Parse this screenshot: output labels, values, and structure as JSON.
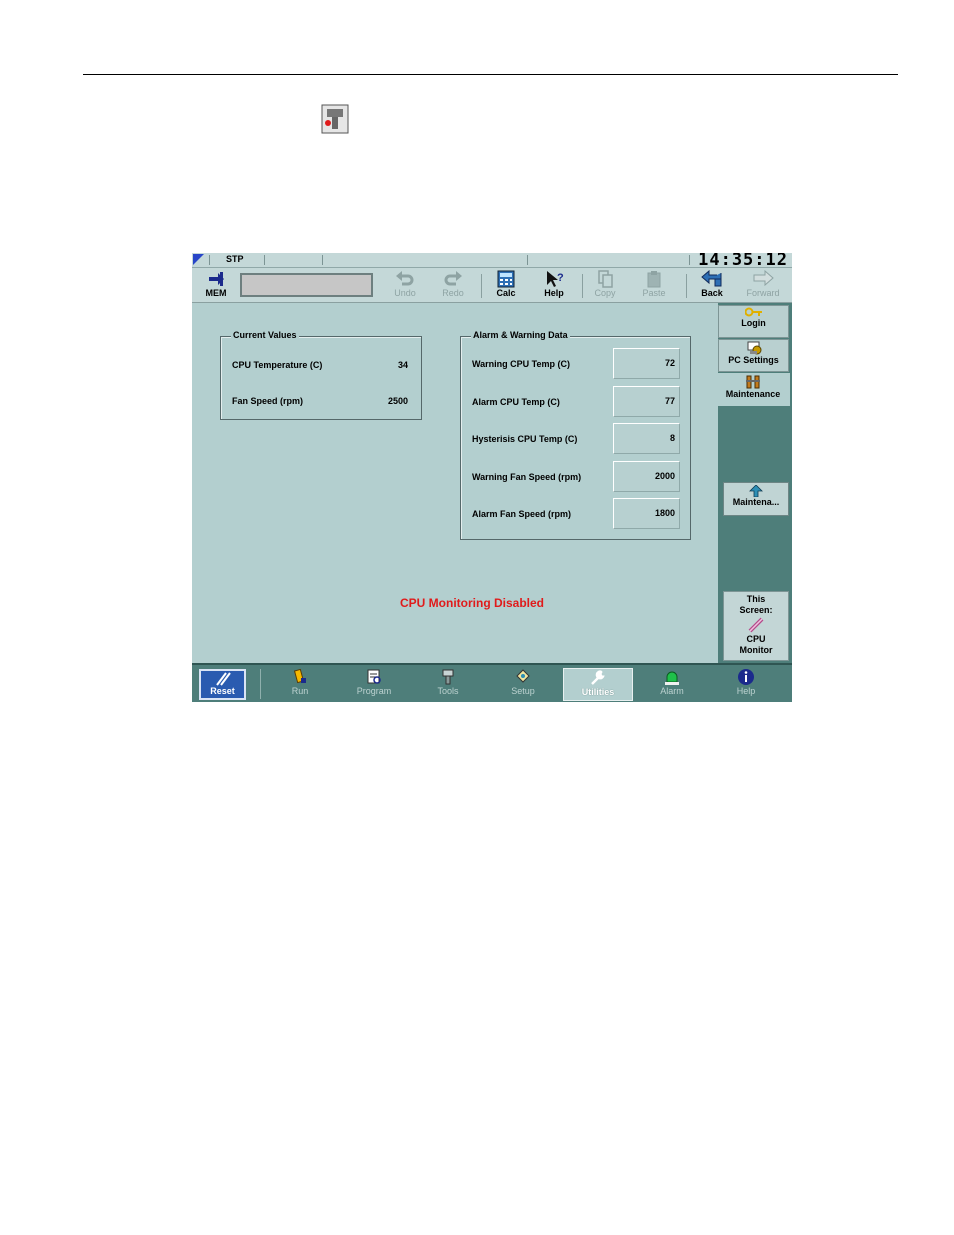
{
  "statusbar": {
    "mode": "STP",
    "clock": "14:35:12"
  },
  "toolbar": {
    "mem": "MEM",
    "undo": "Undo",
    "redo": "Redo",
    "calc": "Calc",
    "help": "Help",
    "copy": "Copy",
    "paste": "Paste",
    "back": "Back",
    "forward": "Forward"
  },
  "sidenav": {
    "login": "Login",
    "pc_settings": "PC Settings",
    "maintenance": "Maintenance",
    "maint_button": "Maintena...",
    "this_screen_line1": "This",
    "this_screen_line2": "Screen:",
    "this_screen_line3": "CPU",
    "this_screen_line4": "Monitor"
  },
  "current_values": {
    "title": "Current Values",
    "rows": [
      {
        "label": "CPU Temperature (C)",
        "value": "34"
      },
      {
        "label": "Fan Speed (rpm)",
        "value": "2500"
      }
    ]
  },
  "alarm_warning": {
    "title": "Alarm & Warning Data",
    "rows": [
      {
        "label": "Warning CPU Temp (C)",
        "value": "72"
      },
      {
        "label": "Alarm CPU Temp (C)",
        "value": "77"
      },
      {
        "label": "Hysterisis CPU Temp (C)",
        "value": "8"
      },
      {
        "label": "Warning Fan Speed (rpm)",
        "value": "2000"
      },
      {
        "label": "Alarm Fan Speed (rpm)",
        "value": "1800"
      }
    ]
  },
  "message": "CPU Monitoring Disabled",
  "taskbar": {
    "reset": "Reset",
    "items": [
      "Run",
      "Program",
      "Tools",
      "Setup",
      "Utilities",
      "Alarm",
      "Help"
    ],
    "active": "Utilities"
  },
  "colors": {
    "screen_bg": "#b3cfcf",
    "nav_bg": "#4e7e7a",
    "reset_blue": "#2a5bb0",
    "message_red": "#e01b1b"
  }
}
